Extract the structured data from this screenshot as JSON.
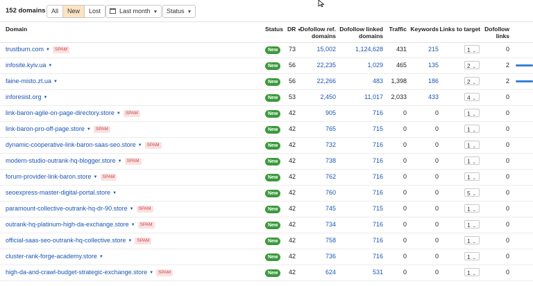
{
  "toolbar": {
    "count": "152 domains",
    "filters": [
      "All",
      "New",
      "Lost"
    ],
    "active_filter": "New",
    "period": "Last month",
    "status_dropdown": "Status"
  },
  "columns": {
    "domain": "Domain",
    "status": "Status",
    "dr": "DR",
    "dofollow_ref": [
      "Dofollow ref.",
      "domains"
    ],
    "dofollow_linked": [
      "Dofollow linked",
      "domains"
    ],
    "traffic": "Traffic",
    "keywords": "Keywords",
    "links_to_target": "Links to target",
    "dofollow_links": [
      "Dofollow",
      "links"
    ]
  },
  "status_label": "New",
  "spam_label": "SPAM",
  "rows": [
    {
      "domain": "trustburn.com",
      "spam": true,
      "dr": "73",
      "ref": "15,002",
      "linked": "1,124,628",
      "traffic": "431",
      "keywords": "215",
      "kw_link": true,
      "ltt": "1",
      "dlinks": "0",
      "bar": false
    },
    {
      "domain": "infosite.kyiv.ua",
      "spam": false,
      "dr": "56",
      "ref": "22,235",
      "linked": "1,029",
      "traffic": "465",
      "keywords": "135",
      "kw_link": true,
      "ltt": "2",
      "dlinks": "2",
      "bar": true
    },
    {
      "domain": "faine-misto.zt.ua",
      "spam": false,
      "dr": "56",
      "ref": "22,266",
      "linked": "483",
      "traffic": "1,398",
      "keywords": "186",
      "kw_link": true,
      "ltt": "2",
      "dlinks": "2",
      "bar": true
    },
    {
      "domain": "inforesist.org",
      "spam": false,
      "dr": "53",
      "ref": "2,450",
      "linked": "11,017",
      "traffic": "2,033",
      "keywords": "433",
      "kw_link": true,
      "ltt": "4",
      "dlinks": "0",
      "bar": false
    },
    {
      "domain": "link-baron-agile-on-page-directory.store",
      "spam": true,
      "dr": "42",
      "ref": "905",
      "linked": "716",
      "traffic": "0",
      "keywords": "0",
      "kw_link": false,
      "ltt": "1",
      "dlinks": "0",
      "bar": false
    },
    {
      "domain": "link-baron-pro-off-page.store",
      "spam": true,
      "dr": "42",
      "ref": "765",
      "linked": "715",
      "traffic": "0",
      "keywords": "0",
      "kw_link": false,
      "ltt": "1",
      "dlinks": "0",
      "bar": false
    },
    {
      "domain": "dynamic-cooperative-link-baron-saas-seo.store",
      "spam": true,
      "dr": "42",
      "ref": "732",
      "linked": "716",
      "traffic": "0",
      "keywords": "0",
      "kw_link": false,
      "ltt": "1",
      "dlinks": "0",
      "bar": false
    },
    {
      "domain": "modern-studio-outrank-hq-blogger.store",
      "spam": true,
      "dr": "42",
      "ref": "738",
      "linked": "716",
      "traffic": "0",
      "keywords": "0",
      "kw_link": false,
      "ltt": "1",
      "dlinks": "0",
      "bar": false
    },
    {
      "domain": "forum-provider-link-baron.store",
      "spam": true,
      "dr": "42",
      "ref": "762",
      "linked": "716",
      "traffic": "0",
      "keywords": "0",
      "kw_link": false,
      "ltt": "1",
      "dlinks": "0",
      "bar": false
    },
    {
      "domain": "seoexpress-master-digital-portal.store",
      "spam": false,
      "dr": "42",
      "ref": "760",
      "linked": "716",
      "traffic": "0",
      "keywords": "0",
      "kw_link": false,
      "ltt": "5",
      "dlinks": "0",
      "bar": false
    },
    {
      "domain": "paramount-collective-outrank-hq-dr-90.store",
      "spam": true,
      "dr": "42",
      "ref": "745",
      "linked": "715",
      "traffic": "0",
      "keywords": "0",
      "kw_link": false,
      "ltt": "1",
      "dlinks": "0",
      "bar": false
    },
    {
      "domain": "outrank-hq-platinum-high-da-exchange.store",
      "spam": true,
      "dr": "42",
      "ref": "734",
      "linked": "716",
      "traffic": "0",
      "keywords": "0",
      "kw_link": false,
      "ltt": "1",
      "dlinks": "0",
      "bar": false
    },
    {
      "domain": "official-saas-seo-outrank-hq-collective.store",
      "spam": true,
      "dr": "42",
      "ref": "758",
      "linked": "716",
      "traffic": "0",
      "keywords": "0",
      "kw_link": false,
      "ltt": "1",
      "dlinks": "0",
      "bar": false
    },
    {
      "domain": "cluster-rank-forge-academy.store",
      "spam": false,
      "dr": "42",
      "ref": "736",
      "linked": "716",
      "traffic": "0",
      "keywords": "0",
      "kw_link": false,
      "ltt": "1",
      "dlinks": "0",
      "bar": false
    },
    {
      "domain": "high-da-and-crawl-budget-strategic-exchange.store",
      "spam": true,
      "dr": "42",
      "ref": "624",
      "linked": "531",
      "traffic": "0",
      "keywords": "0",
      "kw_link": false,
      "ltt": "1",
      "dlinks": "0",
      "bar": false
    }
  ]
}
